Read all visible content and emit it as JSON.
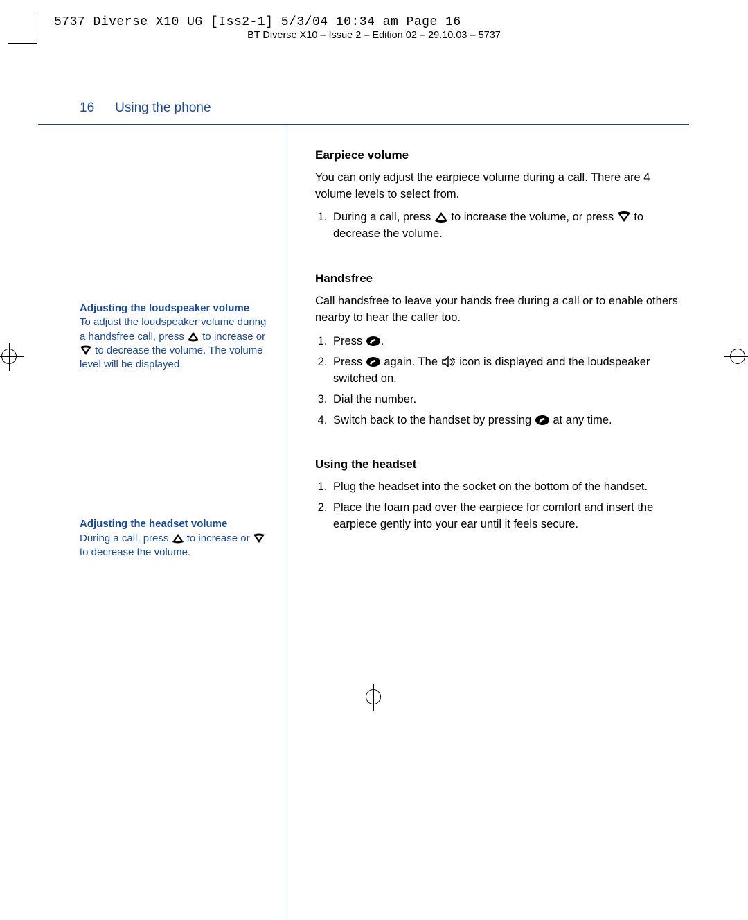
{
  "slug": "5737 Diverse X10 UG [Iss2-1]  5/3/04  10:34 am  Page 16",
  "running_head": "BT Diverse X10 – Issue 2 – Edition 02 – 29.10.03 – 5737",
  "page_number": "16",
  "page_title": "Using the phone",
  "sidebar": {
    "tip1": {
      "head": "Adjusting the loudspeaker volume",
      "t1": "To adjust the loudspeaker volume during a handsfree call, press ",
      "t2": " to increase or ",
      "t3": " to decrease the volume. The volume level will be displayed."
    },
    "tip2": {
      "head": "Adjusting the headset volume",
      "t1": "During a call, press ",
      "t2": " to increase or ",
      "t3": " to decrease the volume."
    }
  },
  "main": {
    "s1": {
      "head": "Earpiece volume",
      "p1": "You can only adjust the earpiece volume during a call. There are 4 volume levels to select from.",
      "li1a": "During a call, press ",
      "li1b": " to increase the volume, or press ",
      "li1c": " to decrease the volume."
    },
    "s2": {
      "head": "Handsfree",
      "p1": "Call handsfree to leave your hands free during a call or to enable others nearby to hear the caller too.",
      "li1a": "Press ",
      "li1b": ".",
      "li2a": "Press ",
      "li2b": " again. The ",
      "li2c": " icon is displayed and the loudspeaker switched on.",
      "li3": "Dial the number.",
      "li4a": "Switch back to the handset by pressing ",
      "li4b": " at any time."
    },
    "s3": {
      "head": "Using the headset",
      "li1": "Plug the headset into the socket on the bottom of the handset.",
      "li2": "Place the foam pad over the earpiece for comfort and insert the earpiece gently into your ear until it feels secure."
    }
  }
}
